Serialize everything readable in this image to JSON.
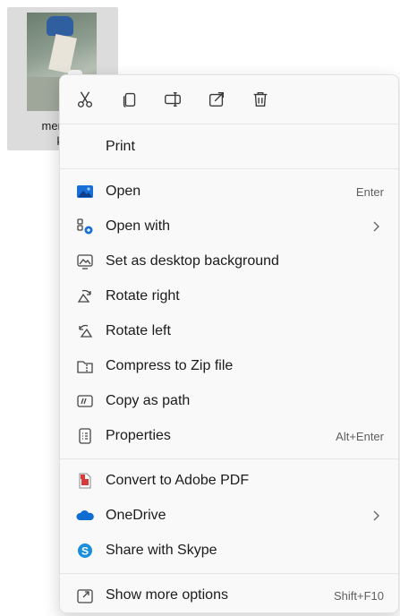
{
  "file": {
    "name_line1": "mens-te",
    "name_line2": "ks"
  },
  "quick_actions": [
    {
      "icon": "cut-icon"
    },
    {
      "icon": "copy-icon"
    },
    {
      "icon": "rename-icon"
    },
    {
      "icon": "share-icon"
    },
    {
      "icon": "delete-icon"
    }
  ],
  "menu": {
    "print": {
      "label": "Print"
    },
    "open": {
      "label": "Open",
      "shortcut": "Enter",
      "icon": "photos-icon"
    },
    "open_with": {
      "label": "Open with",
      "icon": "open-with-icon"
    },
    "set_background": {
      "label": "Set as desktop background",
      "icon": "desktop-background-icon"
    },
    "rotate_right": {
      "label": "Rotate right",
      "icon": "rotate-right-icon"
    },
    "rotate_left": {
      "label": "Rotate left",
      "icon": "rotate-left-icon"
    },
    "compress_zip": {
      "label": "Compress to Zip file",
      "icon": "zip-icon"
    },
    "copy_path": {
      "label": "Copy as path",
      "icon": "copy-path-icon"
    },
    "properties": {
      "label": "Properties",
      "shortcut": "Alt+Enter",
      "icon": "properties-icon"
    },
    "convert_pdf": {
      "label": "Convert to Adobe PDF",
      "icon": "adobe-pdf-icon"
    },
    "onedrive": {
      "label": "OneDrive",
      "icon": "onedrive-icon"
    },
    "skype": {
      "label": "Share with Skype",
      "icon": "skype-icon"
    },
    "more_options": {
      "label": "Show more options",
      "shortcut": "Shift+F10",
      "icon": "more-options-icon"
    }
  },
  "colors": {
    "accent_blue": "#1a6fd6",
    "pdf_red": "#d83b3b",
    "skype_blue": "#1a8fe0",
    "onedrive_blue": "#0f6cd0"
  }
}
